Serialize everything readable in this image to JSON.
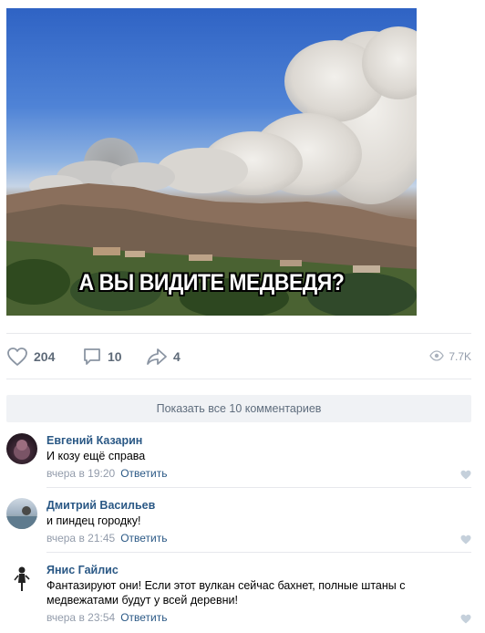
{
  "post": {
    "image_caption": "А ВЫ ВИДИТЕ МЕДВЕДЯ?"
  },
  "actions": {
    "likes": "204",
    "comments": "10",
    "shares": "4",
    "views": "7.7K"
  },
  "show_all": {
    "label": "Показать все 10 комментариев"
  },
  "comments": [
    {
      "author": "Евгений Казарин",
      "text": "И козу ещё справа",
      "time": "вчера в 19:20",
      "reply": "Ответить"
    },
    {
      "author": "Дмитрий Васильев",
      "text": "и пиндец городку!",
      "time": "вчера в 21:45",
      "reply": "Ответить"
    },
    {
      "author": "Янис Гайлис",
      "text": "Фантазируют они! Если этот вулкан сейчас бахнет, полные штаны с медвежатами будут у всей деревни!",
      "time": "вчера в 23:54",
      "reply": "Ответить"
    }
  ],
  "colors": {
    "link": "#2a5885",
    "meta": "#939cab",
    "action": "#5e6a78",
    "show_all_bg": "#f0f2f5"
  },
  "icons": [
    "heart-icon",
    "comment-icon",
    "share-arrow-icon",
    "eye-icon",
    "like-small-icon"
  ]
}
